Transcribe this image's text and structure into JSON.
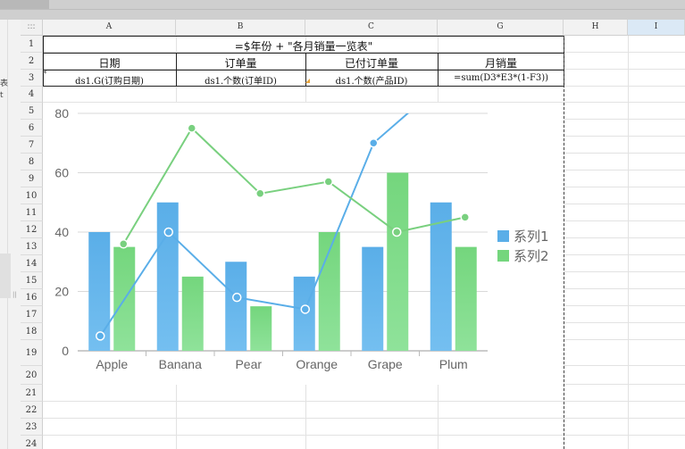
{
  "columns": [
    {
      "id": "corner",
      "label": ":::"
    },
    {
      "id": "A",
      "label": "A"
    },
    {
      "id": "B",
      "label": "B"
    },
    {
      "id": "C",
      "label": "C"
    },
    {
      "id": "G",
      "label": "G"
    },
    {
      "id": "H",
      "label": "H"
    },
    {
      "id": "I",
      "label": "I"
    }
  ],
  "rows": [
    "1",
    "2",
    "3",
    "4",
    "5",
    "6",
    "7",
    "8",
    "9",
    "10",
    "11",
    "12",
    "13",
    "14",
    "15",
    "16",
    "17",
    "18",
    "19",
    "20",
    "21",
    "22",
    "23",
    "24"
  ],
  "sheet": {
    "title_formula": "=$年份 + \"各月销量一览表\"",
    "headers": [
      "日期",
      "订单量",
      "已付订单量",
      "月销量"
    ],
    "row3": [
      "ds1.G(订购日期)",
      "ds1.个数(订单ID)",
      "ds1.个数(产品ID)",
      "=sum(D3*E3*(1-F3))"
    ],
    "row3_marker": "*"
  },
  "left_panel": {
    "fragment1": "表",
    "fragment2": "t"
  },
  "colors": {
    "series1": "#5aaee8",
    "series2": "#74d67d",
    "series1_line": "#5aaee8",
    "series2_line": "#79d07f",
    "axis_text": "#666666"
  },
  "chart_data": {
    "type": "bar",
    "categories": [
      "Apple",
      "Banana",
      "Pear",
      "Orange",
      "Grape",
      "Plum"
    ],
    "ylim": [
      0,
      80
    ],
    "yticks": [
      0,
      20,
      40,
      60,
      80
    ],
    "grid": true,
    "legend_position": "right",
    "series": [
      {
        "name": "系列1",
        "kind": "bar",
        "values": [
          40,
          50,
          30,
          25,
          35,
          50
        ]
      },
      {
        "name": "系列2",
        "kind": "bar",
        "values": [
          35,
          25,
          15,
          40,
          60,
          35
        ]
      }
    ],
    "lines": [
      {
        "series": "系列1",
        "values": [
          5,
          40,
          18,
          14,
          70,
          90
        ]
      },
      {
        "series": "系列2",
        "values": [
          36,
          75,
          53,
          57,
          40,
          45
        ]
      }
    ]
  }
}
